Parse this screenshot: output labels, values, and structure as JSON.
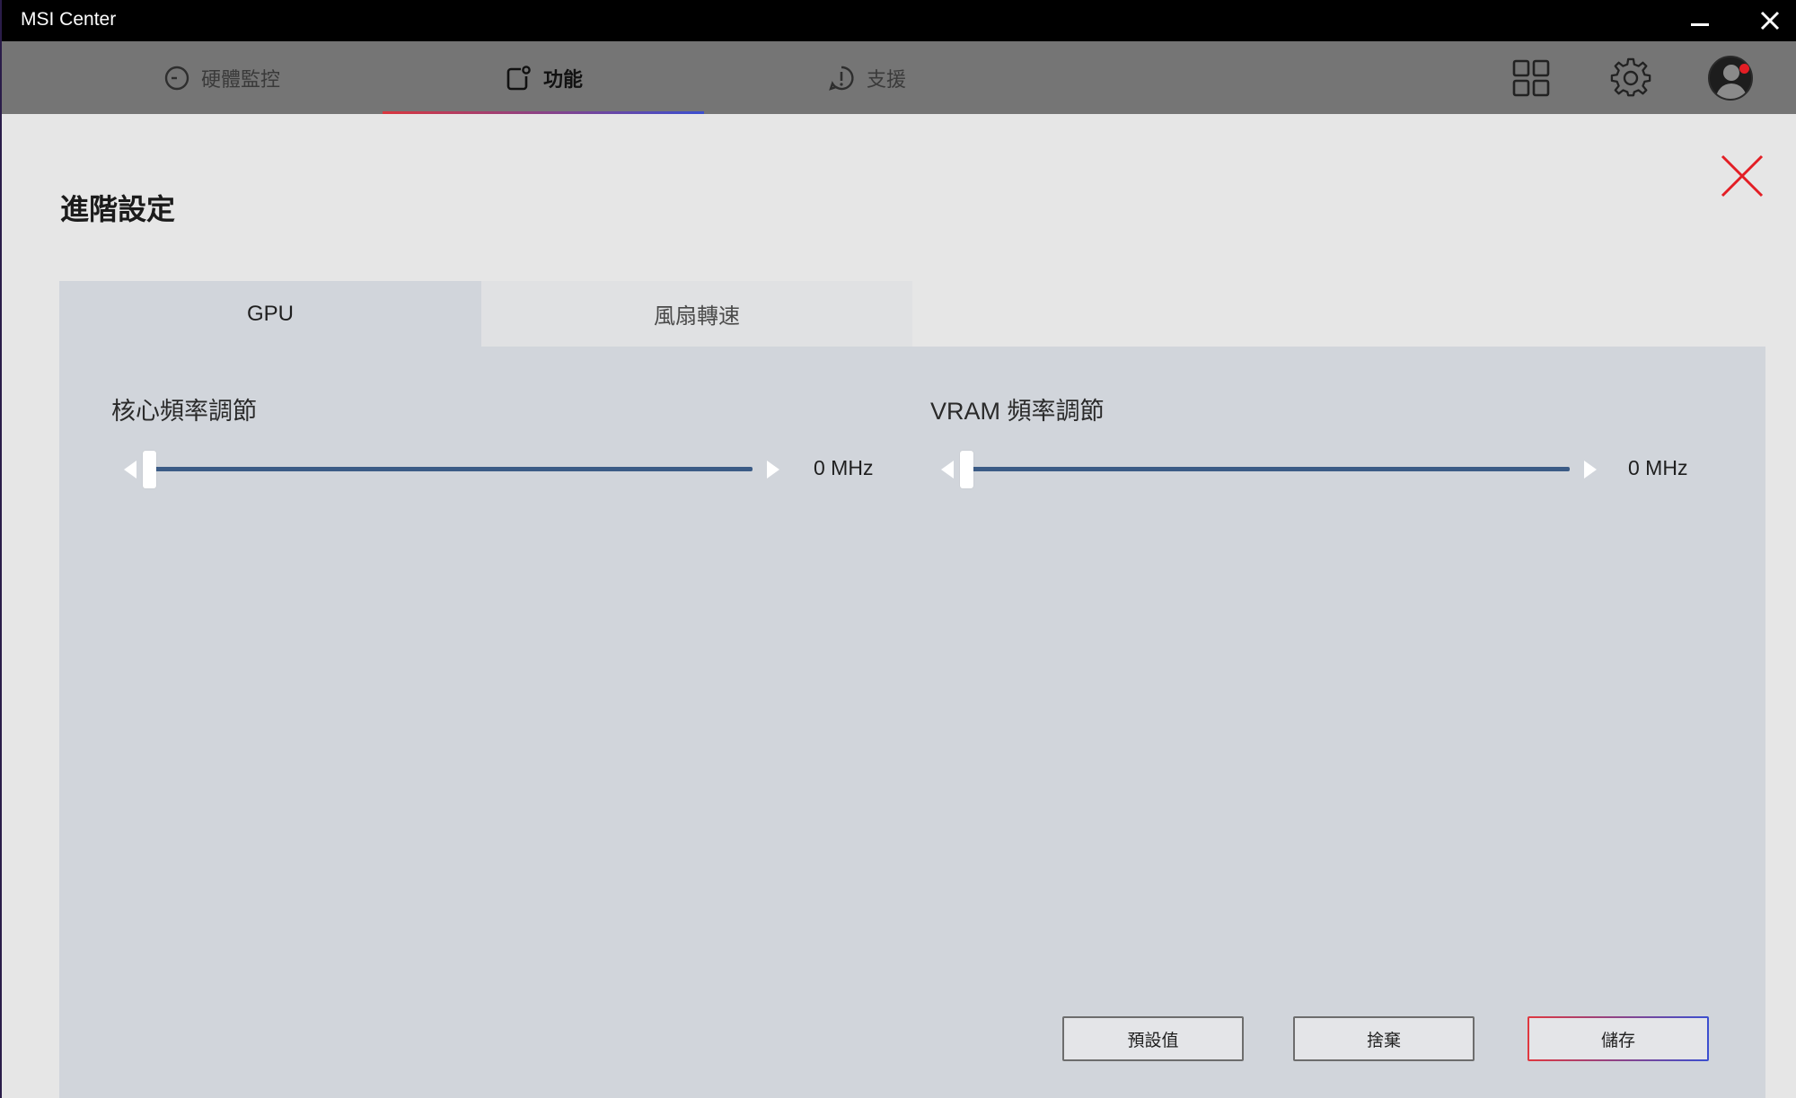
{
  "window": {
    "title": "MSI Center"
  },
  "nav": {
    "tabs": [
      {
        "label": "硬體監控",
        "icon": "gauge-icon",
        "active": false
      },
      {
        "label": "功能",
        "icon": "function-icon",
        "active": true
      },
      {
        "label": "支援",
        "icon": "support-icon",
        "active": false
      }
    ],
    "icons": [
      "apps-grid-icon",
      "gear-icon",
      "avatar-icon"
    ]
  },
  "page": {
    "title": "進階設定",
    "tabs": [
      {
        "label": "GPU",
        "active": true
      },
      {
        "label": "風扇轉速",
        "active": false
      }
    ],
    "sliders": {
      "core": {
        "label": "核心頻率調節",
        "value": "0 MHz",
        "position": 0
      },
      "vram": {
        "label": "VRAM 頻率調節",
        "value": "0 MHz",
        "position": 0
      }
    },
    "buttons": {
      "default": "預設值",
      "discard": "捨棄",
      "save": "儲存"
    }
  },
  "colors": {
    "accent_red": "#e31e25",
    "accent_blue": "#3b4fd0",
    "track_fill": "#3b5b86"
  }
}
